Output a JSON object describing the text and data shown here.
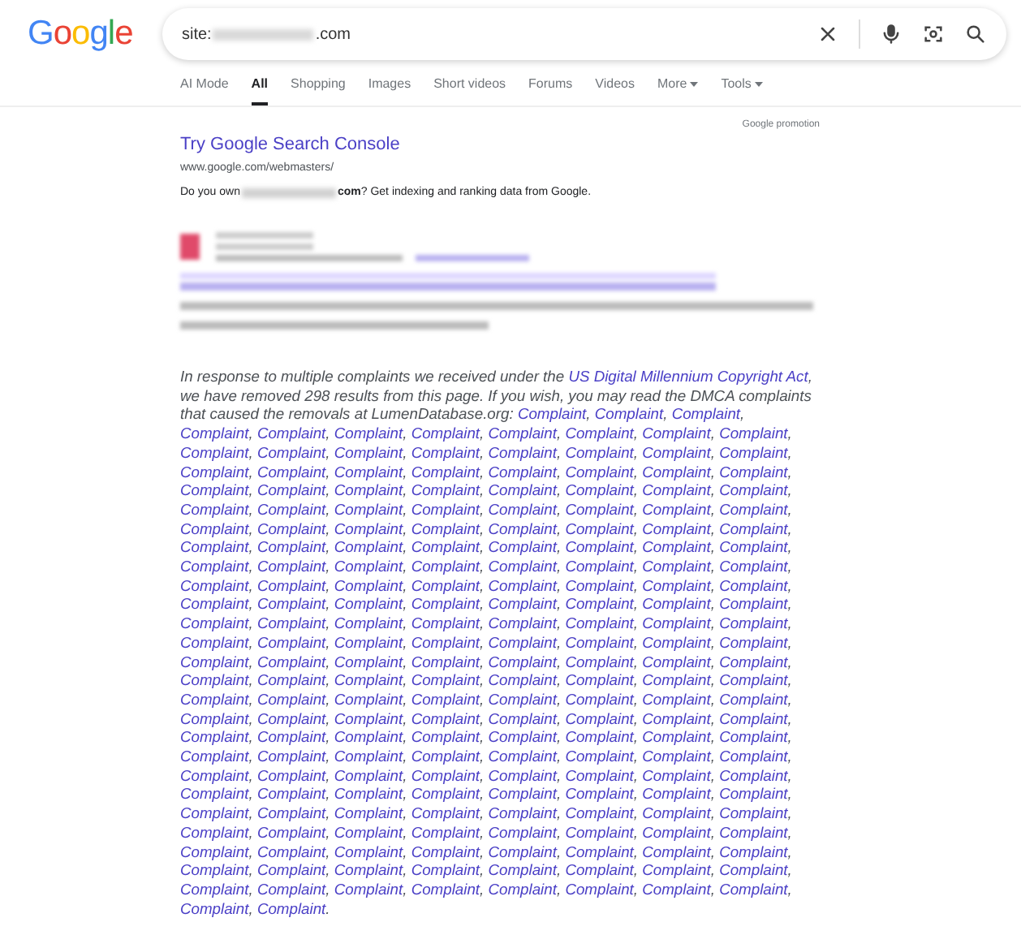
{
  "logo": "Google",
  "search": {
    "prefix": "site:",
    "suffix": ".com"
  },
  "tabs": [
    {
      "label": "AI Mode",
      "selected": false,
      "dropdown": false
    },
    {
      "label": "All",
      "selected": true,
      "dropdown": false
    },
    {
      "label": "Shopping",
      "selected": false,
      "dropdown": false
    },
    {
      "label": "Images",
      "selected": false,
      "dropdown": false
    },
    {
      "label": "Short videos",
      "selected": false,
      "dropdown": false
    },
    {
      "label": "Forums",
      "selected": false,
      "dropdown": false
    },
    {
      "label": "Videos",
      "selected": false,
      "dropdown": false
    },
    {
      "label": "More",
      "selected": false,
      "dropdown": true
    },
    {
      "label": "Tools",
      "selected": false,
      "dropdown": true
    }
  ],
  "promotion": {
    "label": "Google promotion",
    "title": "Try Google Search Console",
    "url": "www.google.com/webmasters/",
    "desc_before": "Do you own",
    "desc_after": "**com**? Get indexing and ranking data from Google."
  },
  "notice": {
    "text_1": "In response to multiple complaints we received under the",
    "link": "US Digital Millennium Copyright Act",
    "text_2": ", we have removed 298 results from this page. If you wish, you may read the DMCA complaints that caused the removals at LumenDatabase.org:",
    "separator": ", ",
    "end": ".",
    "complaints": [
      "Complaint",
      "Complaint",
      "Complaint",
      "Complaint",
      "Complaint",
      "Complaint",
      "Complaint",
      "Complaint",
      "Complaint",
      "Complaint",
      "Complaint",
      "Complaint",
      "Complaint",
      "Complaint",
      "Complaint",
      "Complaint",
      "Complaint",
      "Complaint",
      "Complaint",
      "Complaint",
      "Complaint",
      "Complaint",
      "Complaint",
      "Complaint",
      "Complaint",
      "Complaint",
      "Complaint",
      "Complaint",
      "Complaint",
      "Complaint",
      "Complaint",
      "Complaint",
      "Complaint",
      "Complaint",
      "Complaint",
      "Complaint",
      "Complaint",
      "Complaint",
      "Complaint",
      "Complaint",
      "Complaint",
      "Complaint",
      "Complaint",
      "Complaint",
      "Complaint",
      "Complaint",
      "Complaint",
      "Complaint",
      "Complaint",
      "Complaint",
      "Complaint",
      "Complaint",
      "Complaint",
      "Complaint",
      "Complaint",
      "Complaint",
      "Complaint",
      "Complaint",
      "Complaint",
      "Complaint",
      "Complaint",
      "Complaint",
      "Complaint",
      "Complaint",
      "Complaint",
      "Complaint",
      "Complaint",
      "Complaint",
      "Complaint",
      "Complaint",
      "Complaint",
      "Complaint",
      "Complaint",
      "Complaint",
      "Complaint",
      "Complaint",
      "Complaint",
      "Complaint",
      "Complaint",
      "Complaint",
      "Complaint",
      "Complaint",
      "Complaint",
      "Complaint",
      "Complaint",
      "Complaint",
      "Complaint",
      "Complaint",
      "Complaint",
      "Complaint",
      "Complaint",
      "Complaint",
      "Complaint",
      "Complaint",
      "Complaint",
      "Complaint",
      "Complaint",
      "Complaint",
      "Complaint",
      "Complaint",
      "Complaint",
      "Complaint",
      "Complaint",
      "Complaint",
      "Complaint",
      "Complaint",
      "Complaint",
      "Complaint",
      "Complaint",
      "Complaint",
      "Complaint",
      "Complaint",
      "Complaint",
      "Complaint",
      "Complaint",
      "Complaint",
      "Complaint",
      "Complaint",
      "Complaint",
      "Complaint",
      "Complaint",
      "Complaint",
      "Complaint",
      "Complaint",
      "Complaint",
      "Complaint",
      "Complaint",
      "Complaint",
      "Complaint",
      "Complaint",
      "Complaint",
      "Complaint",
      "Complaint",
      "Complaint",
      "Complaint",
      "Complaint",
      "Complaint",
      "Complaint",
      "Complaint",
      "Complaint",
      "Complaint",
      "Complaint",
      "Complaint",
      "Complaint",
      "Complaint",
      "Complaint",
      "Complaint",
      "Complaint",
      "Complaint",
      "Complaint",
      "Complaint",
      "Complaint",
      "Complaint",
      "Complaint",
      "Complaint",
      "Complaint",
      "Complaint",
      "Complaint",
      "Complaint",
      "Complaint",
      "Complaint",
      "Complaint",
      "Complaint",
      "Complaint",
      "Complaint",
      "Complaint",
      "Complaint",
      "Complaint",
      "Complaint",
      "Complaint",
      "Complaint",
      "Complaint",
      "Complaint",
      "Complaint",
      "Complaint",
      "Complaint",
      "Complaint",
      "Complaint",
      "Complaint",
      "Complaint",
      "Complaint",
      "Complaint",
      "Complaint",
      "Complaint",
      "Complaint",
      "Complaint",
      "Complaint",
      "Complaint",
      "Complaint",
      "Complaint",
      "Complaint",
      "Complaint",
      "Complaint",
      "Complaint",
      "Complaint",
      "Complaint",
      "Complaint",
      "Complaint",
      "Complaint",
      "Complaint",
      "Complaint",
      "Complaint",
      "Complaint",
      "Complaint",
      "Complaint"
    ]
  }
}
